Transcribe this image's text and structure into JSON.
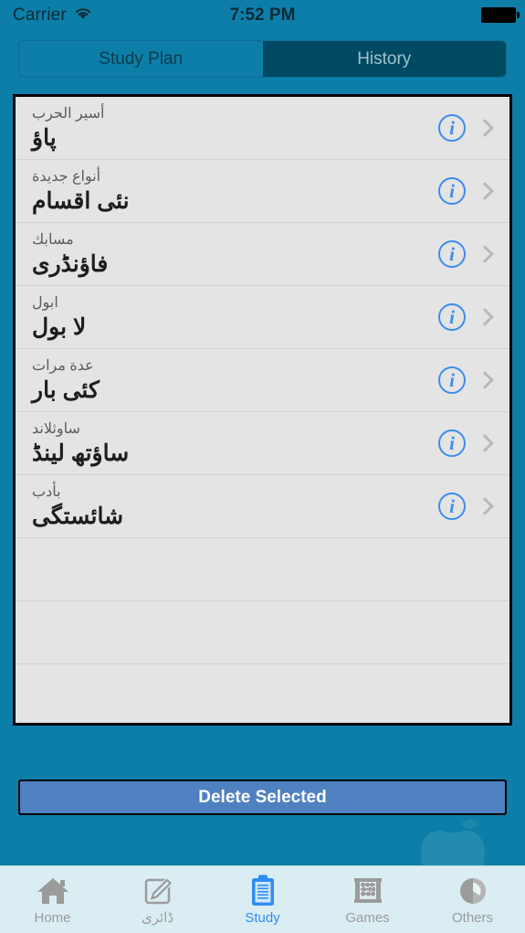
{
  "statusbar": {
    "carrier": "Carrier",
    "time": "7:52 PM",
    "wifi_icon": "wifi-icon",
    "battery_icon": "battery-icon"
  },
  "segmented_control": {
    "options": [
      {
        "label": "Study Plan",
        "active": false
      },
      {
        "label": "History",
        "active": true
      }
    ]
  },
  "list": {
    "rows": [
      {
        "sub": "أسير الحرب",
        "title": "پاؤ"
      },
      {
        "sub": "أنواع جديدة",
        "title": "نئى اقسام"
      },
      {
        "sub": "مسابك",
        "title": "فاؤنڈرى"
      },
      {
        "sub": "ابول",
        "title": "لا بول"
      },
      {
        "sub": "عدة مرات",
        "title": "كئى بار"
      },
      {
        "sub": "ساوثلاند",
        "title": "ساؤتھ لينڈ"
      },
      {
        "sub": "بأدب",
        "title": "شائستگى"
      }
    ],
    "empty_row_count": 3,
    "info_icon": "info-icon",
    "chevron_icon": "chevron-right-icon"
  },
  "delete_button": {
    "label": "Delete Selected"
  },
  "tabbar": {
    "tabs": [
      {
        "label": "Home",
        "icon": "home-icon",
        "active": false
      },
      {
        "label": "ڈائری",
        "icon": "edit-note-icon",
        "active": false
      },
      {
        "label": "Study",
        "icon": "clipboard-icon",
        "active": true
      },
      {
        "label": "Games",
        "icon": "abacus-icon",
        "active": false
      },
      {
        "label": "Others",
        "icon": "pie-circle-icon",
        "active": false
      }
    ]
  },
  "colors": {
    "background_teal": "#0d7ea8",
    "segment_active": "#004963",
    "list_background": "#e4e4e4",
    "delete_button": "#4f80c0",
    "info_blue": "#3c8cf0",
    "tabbar_background": "#daedf2",
    "tab_active": "#2f8cf5",
    "tab_inactive": "#9b9b9b"
  }
}
